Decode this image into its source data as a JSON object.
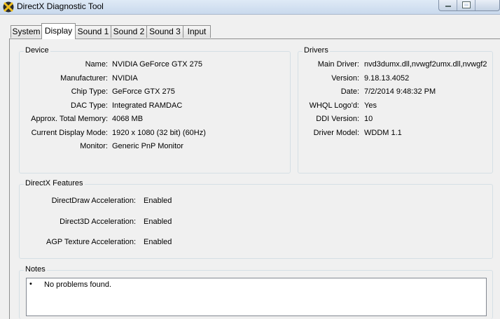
{
  "window": {
    "title": "DirectX Diagnostic Tool"
  },
  "tabs": [
    {
      "label": "System"
    },
    {
      "label": "Display"
    },
    {
      "label": "Sound 1"
    },
    {
      "label": "Sound 2"
    },
    {
      "label": "Sound 3"
    },
    {
      "label": "Input"
    }
  ],
  "active_tab": "Display",
  "device": {
    "title": "Device",
    "rows": [
      {
        "label": "Name:",
        "value": "NVIDIA GeForce GTX 275"
      },
      {
        "label": "Manufacturer:",
        "value": "NVIDIA"
      },
      {
        "label": "Chip Type:",
        "value": "GeForce GTX 275"
      },
      {
        "label": "DAC Type:",
        "value": "Integrated RAMDAC"
      },
      {
        "label": "Approx. Total Memory:",
        "value": "4068 MB"
      },
      {
        "label": "Current Display Mode:",
        "value": "1920 x 1080 (32 bit) (60Hz)"
      },
      {
        "label": "Monitor:",
        "value": "Generic PnP Monitor"
      }
    ]
  },
  "drivers": {
    "title": "Drivers",
    "rows": [
      {
        "label": "Main Driver:",
        "value": "nvd3dumx.dll,nvwgf2umx.dll,nvwgf2"
      },
      {
        "label": "Version:",
        "value": "9.18.13.4052"
      },
      {
        "label": "Date:",
        "value": "7/2/2014 9:48:32 PM"
      },
      {
        "label": "WHQL Logo'd:",
        "value": "Yes"
      },
      {
        "label": "DDI Version:",
        "value": "10"
      },
      {
        "label": "Driver Model:",
        "value": "WDDM 1.1"
      }
    ]
  },
  "features": {
    "title": "DirectX Features",
    "rows": [
      {
        "label": "DirectDraw Acceleration:",
        "value": "Enabled"
      },
      {
        "label": "Direct3D Acceleration:",
        "value": "Enabled"
      },
      {
        "label": "AGP Texture Acceleration:",
        "value": "Enabled"
      }
    ]
  },
  "notes": {
    "title": "Notes",
    "items": [
      "No problems found."
    ]
  }
}
